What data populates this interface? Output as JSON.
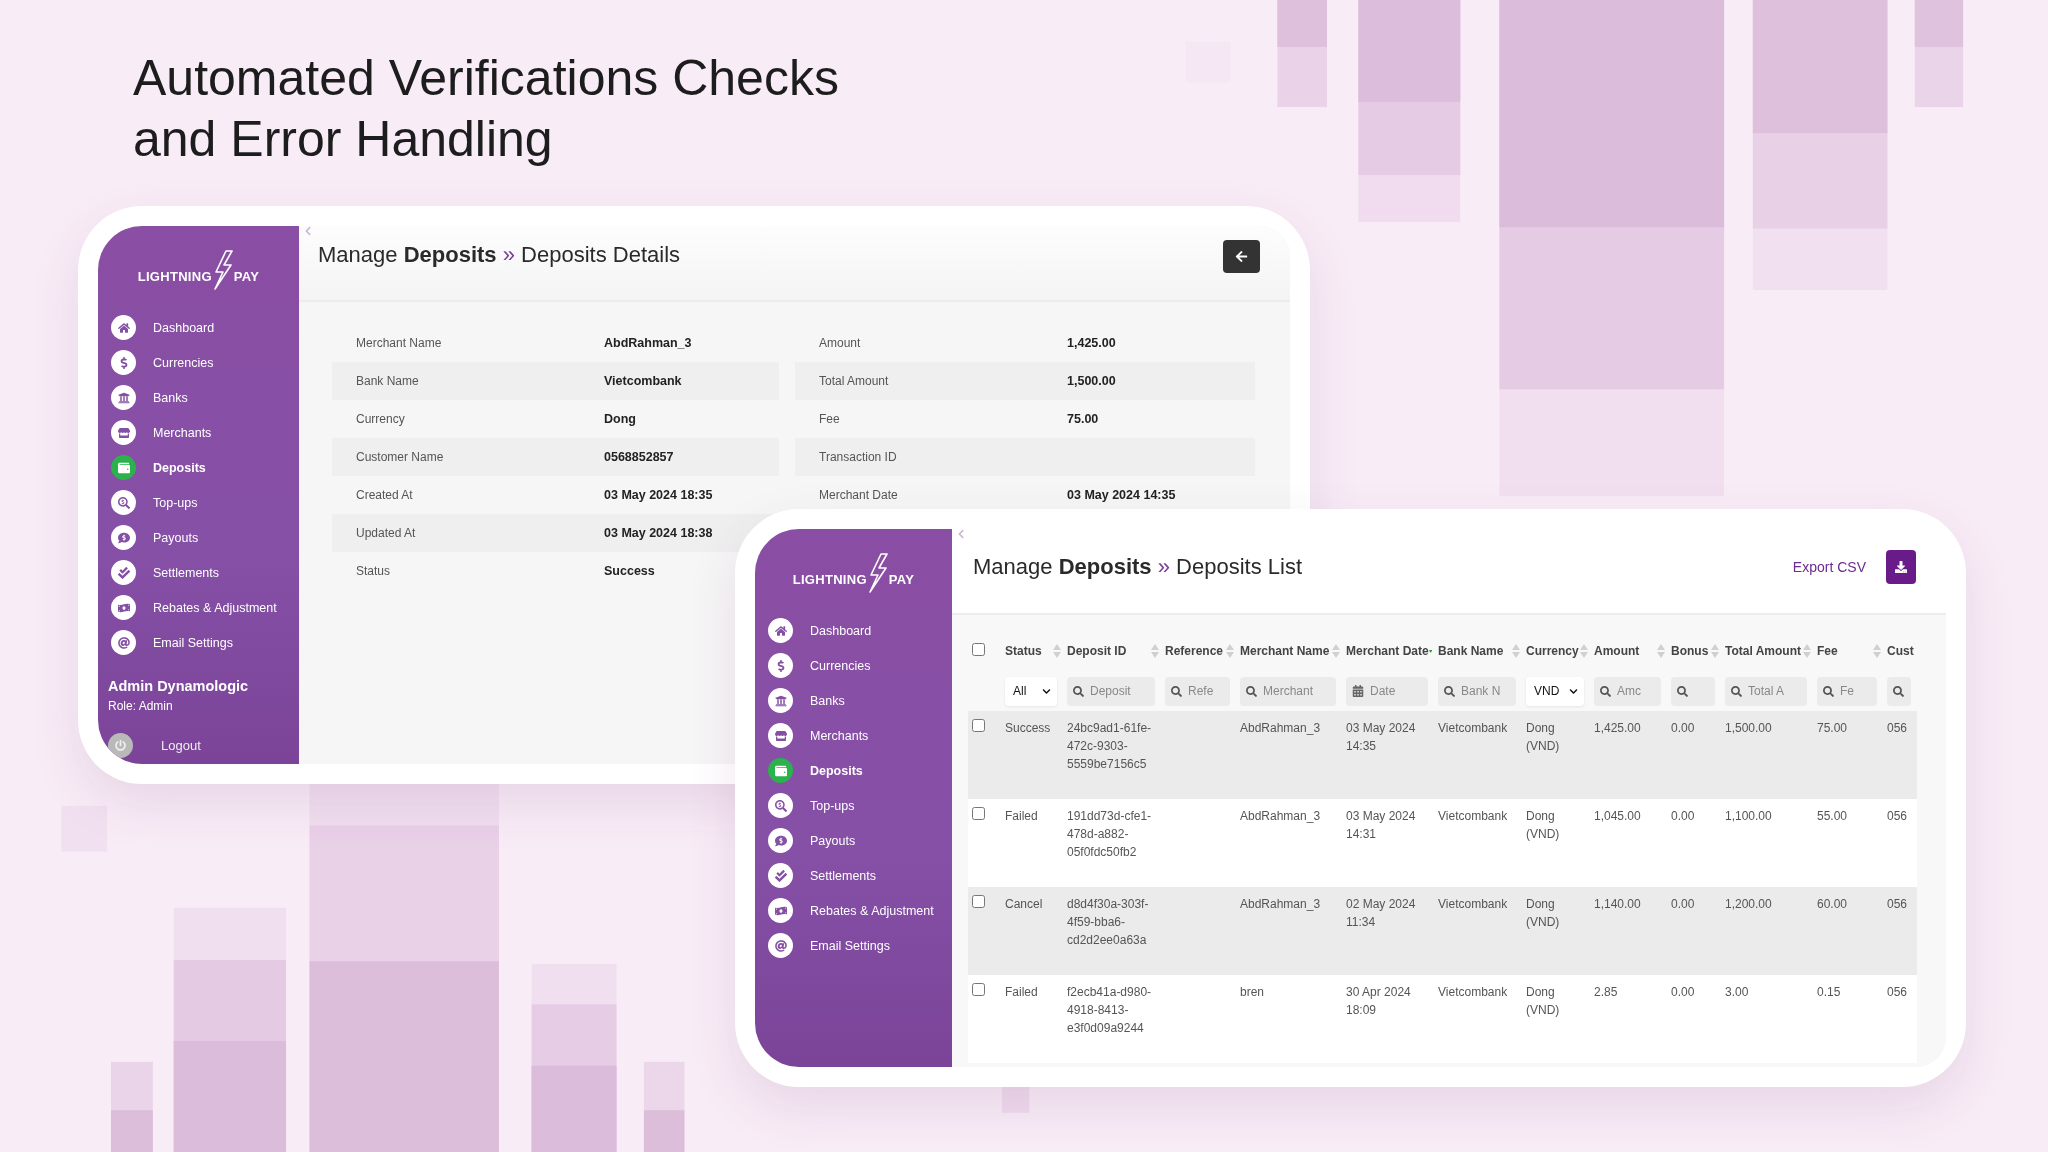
{
  "heading": "Automated Verifications Checks and Error Handling",
  "details_screen": {
    "sidebar": {
      "logo": {
        "left": "LIGHTNING",
        "right": "PAY"
      },
      "nav": [
        {
          "label": "Dashboard",
          "selected": false
        },
        {
          "label": "Currencies",
          "selected": false
        },
        {
          "label": "Banks",
          "selected": false
        },
        {
          "label": "Merchants",
          "selected": false
        },
        {
          "label": "Deposits",
          "selected": true
        },
        {
          "label": "Top-ups",
          "selected": false
        },
        {
          "label": "Payouts",
          "selected": false
        },
        {
          "label": "Settlements",
          "selected": false
        },
        {
          "label": "Rebates & Adjustment",
          "selected": false
        },
        {
          "label": "Email Settings",
          "selected": false
        }
      ],
      "user": {
        "name": "Admin Dynamologic",
        "role": "Role: Admin"
      },
      "logout": "Logout"
    },
    "title": {
      "prefix": "Manage",
      "entity": "Deposits",
      "separator": "»",
      "page": "Deposits Details"
    },
    "details": {
      "left": [
        {
          "label": "Merchant Name",
          "value": "AbdRahman_3"
        },
        {
          "label": "Bank Name",
          "value": "Vietcombank"
        },
        {
          "label": "Currency",
          "value": "Dong"
        },
        {
          "label": "Customer Name",
          "value": "0568852857"
        },
        {
          "label": "Created At",
          "value": "03 May 2024 18:35"
        },
        {
          "label": "Updated At",
          "value": "03 May 2024 18:38"
        },
        {
          "label": "Status",
          "value": "Success"
        }
      ],
      "right": [
        {
          "label": "Amount",
          "value": "1,425.00"
        },
        {
          "label": "Total Amount",
          "value": "1,500.00"
        },
        {
          "label": "Fee",
          "value": "75.00"
        },
        {
          "label": "Transaction ID"
        },
        {
          "label": "Merchant Date",
          "value": "03 May 2024 14:35"
        }
      ]
    }
  },
  "list_screen": {
    "sidebar": {
      "logo": {
        "left": "LIGHTNING",
        "right": "PAY"
      },
      "nav": [
        {
          "label": "Dashboard",
          "selected": false
        },
        {
          "label": "Currencies",
          "selected": false
        },
        {
          "label": "Banks",
          "selected": false
        },
        {
          "label": "Merchants",
          "selected": false
        },
        {
          "label": "Deposits",
          "selected": true
        },
        {
          "label": "Top-ups",
          "selected": false
        },
        {
          "label": "Payouts",
          "selected": false
        },
        {
          "label": "Settlements",
          "selected": false
        },
        {
          "label": "Rebates & Adjustment",
          "selected": false
        },
        {
          "label": "Email Settings",
          "selected": false
        }
      ]
    },
    "title": {
      "prefix": "Manage",
      "entity": "Deposits",
      "separator": "»",
      "page": "Deposits List"
    },
    "export_label": "Export CSV",
    "table": {
      "all_checked": false,
      "columns": [
        {
          "label": "Status",
          "sorted": false,
          "filter": {
            "kind": "select",
            "value": "All"
          }
        },
        {
          "label": "Deposit ID",
          "sorted": false,
          "filter": {
            "kind": "search",
            "placeholder": "Deposit"
          }
        },
        {
          "label": "Reference",
          "sorted": false,
          "filter": {
            "kind": "search",
            "placeholder": "Refe"
          }
        },
        {
          "label": "Merchant Name",
          "sorted": false,
          "filter": {
            "kind": "search",
            "placeholder": "Merchant"
          }
        },
        {
          "label": "Merchant Date",
          "sorted": true,
          "filter": {
            "kind": "date",
            "placeholder": "Date"
          }
        },
        {
          "label": "Bank Name",
          "sorted": false,
          "filter": {
            "kind": "search",
            "placeholder": "Bank N"
          }
        },
        {
          "label": "Currency",
          "sorted": false,
          "filter": {
            "kind": "select",
            "value": "VND"
          }
        },
        {
          "label": "Amount",
          "sorted": false,
          "filter": {
            "kind": "search",
            "placeholder": "Amc"
          }
        },
        {
          "label": "Bonus",
          "sorted": false,
          "filter": {
            "kind": "search"
          }
        },
        {
          "label": "Total Amount",
          "sorted": false,
          "filter": {
            "kind": "search",
            "placeholder": "Total A"
          }
        },
        {
          "label": "Fee",
          "sorted": false,
          "filter": {
            "kind": "search",
            "placeholder": "Fe"
          }
        },
        {
          "label": "Cust",
          "filter": {
            "kind": "search"
          }
        }
      ],
      "rows": [
        {
          "checked": false,
          "cells": [
            "Success",
            "24bc9ad1-61fe-472c-9303-5559be7156c5",
            null,
            "AbdRahman_3",
            "03 May 2024 14:35",
            "Vietcombank",
            "Dong (VND)",
            "1,425.00",
            "0.00",
            "1,500.00",
            "75.00",
            "056"
          ]
        },
        {
          "checked": false,
          "cells": [
            "Failed",
            "191dd73d-cfe1-478d-a882-05f0fdc50fb2",
            null,
            "AbdRahman_3",
            "03 May 2024 14:31",
            "Vietcombank",
            "Dong (VND)",
            "1,045.00",
            "0.00",
            "1,100.00",
            "55.00",
            "056"
          ]
        },
        {
          "checked": false,
          "cells": [
            "Cancel",
            "d8d4f30a-303f-4f59-bba6-cd2d2ee0a63a",
            null,
            "AbdRahman_3",
            "02 May 2024 11:34",
            "Vietcombank",
            "Dong (VND)",
            "1,140.00",
            "0.00",
            "1,200.00",
            "60.00",
            "056"
          ]
        },
        {
          "checked": false,
          "cells": [
            "Failed",
            "f2ecb41a-d980-4918-8413-e3f0d09a9244",
            null,
            "bren",
            "30 Apr 2024 18:09",
            "Vietcombank",
            "Dong (VND)",
            "2.85",
            "0.00",
            "3.00",
            "0.15",
            "056"
          ]
        }
      ]
    }
  }
}
